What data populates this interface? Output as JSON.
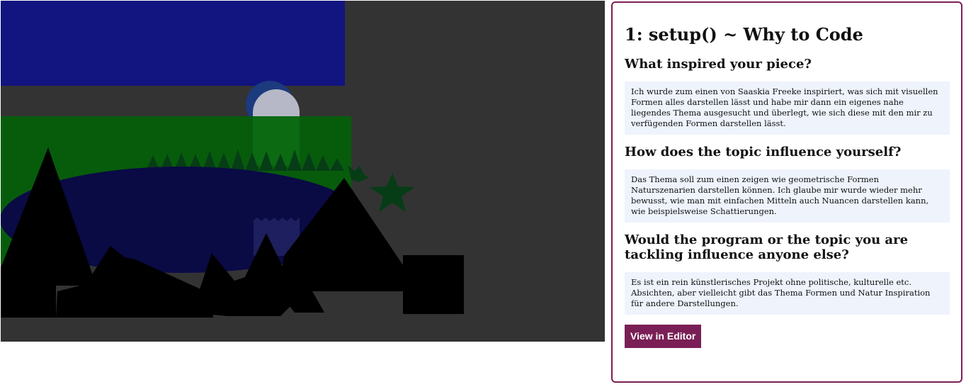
{
  "panel": {
    "title": "1: setup() ~ Why to Code",
    "questions": [
      {
        "question": "What inspired your piece?",
        "answer": "Ich wurde zum einen von Saaskia Freeke inspiriert, was sich mit visuellen Formen alles darstellen lässt und habe mir dann ein eigenes nahe liegendes Thema ausgesucht und überlegt, wie sich diese mit den mir zu verfügenden Formen darstellen lässt."
      },
      {
        "question": "How does the topic influence yourself?",
        "answer": "Das Thema soll zum einen zeigen wie geometrische Formen Naturszenarien darstellen können. Ich glaube mir wurde wieder mehr bewusst, wie man mit einfachen Mitteln auch Nuancen darstellen kann, wie beispielsweise Schattierungen."
      },
      {
        "question": "Would the program or the topic you are tackling influence anyone else?",
        "answer": "Es ist ein rein künstlerisches Projekt ohne politische, kulturelle etc. Absichten, aber vielleicht gibt das Thema Formen und Natur Inspiration für andere Darstellungen."
      }
    ],
    "button_label": "View in Editor"
  },
  "colors": {
    "canvas_bg": "#333333",
    "sky": "#12147f",
    "moon_halo": "#1c3a7e",
    "moon": "#b6b8c7",
    "forest": "#075c0c",
    "lake": "#0a0a45",
    "trees": "#063d16",
    "reflection": "#1d1f5e",
    "mountains": "#000000",
    "accent": "#7a1f55",
    "answer_bg": "#eef3fc"
  }
}
